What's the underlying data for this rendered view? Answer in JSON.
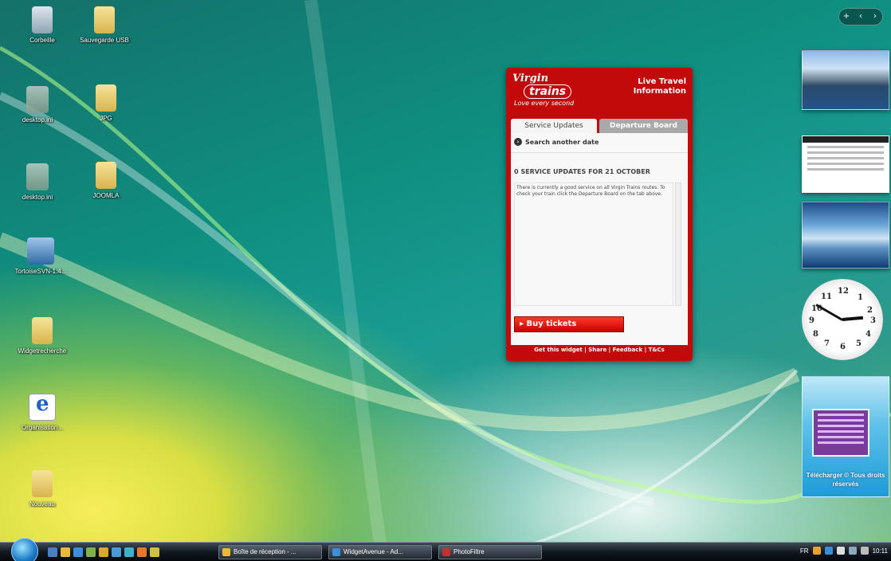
{
  "desktop": {
    "icons": [
      {
        "label": "Corbeille",
        "icon": "recycle-bin-icon"
      },
      {
        "label": "Sauvegarde USB",
        "icon": "folder-icon"
      },
      {
        "label": "desktop.ini",
        "icon": "settings-file-icon"
      },
      {
        "label": "JPG",
        "icon": "folder-icon"
      },
      {
        "label": "desktop.ini",
        "icon": "settings-file-icon"
      },
      {
        "label": "JOOMLA",
        "icon": "folder-icon"
      },
      {
        "label": "TortoiseSVN-1.4...",
        "icon": "installer-icon"
      },
      {
        "label": "Widgetrecherche",
        "icon": "folder-icon"
      },
      {
        "label": "Organisation...",
        "icon": "internet-explorer-icon"
      },
      {
        "label": "Nouveau",
        "icon": "folder-icon"
      }
    ]
  },
  "sidebar_controls": {
    "add": "+",
    "prev": "‹",
    "next": "›"
  },
  "virgin_widget": {
    "brand": "Virgin",
    "brand_sub": "trains",
    "tagline": "Love every second",
    "header": "Live Travel Information",
    "tabs": [
      "Service Updates",
      "Departure Board"
    ],
    "search_link": "Search another date",
    "updates_heading": "0 SERVICE UPDATES FOR 21 OCTOBER",
    "body_text": "There is currently a good service on all Virgin Trains routes. To check your train click the Departure Board on the tab above.",
    "buy_button": "Buy tickets",
    "footer": "Get this widget | Share | Feedback | T&Cs",
    "accent": "#c20a0a"
  },
  "clock": {
    "numerals": [
      "12",
      "1",
      "2",
      "3",
      "4",
      "5",
      "6",
      "7",
      "8",
      "9",
      "10",
      "11"
    ],
    "hour": 2,
    "minute": 50
  },
  "promo_gadget": {
    "text": "Télécharger © Tous droits réservés"
  },
  "taskbar": {
    "tasks": [
      {
        "label": "Boîte de réception - ...",
        "icon": "mail-icon"
      },
      {
        "label": "WidgetAvenue - Ad...",
        "icon": "browser-icon"
      },
      {
        "label": "PhotoFiltre",
        "icon": "photo-editor-icon"
      }
    ],
    "language": "FR",
    "time": "10:11"
  }
}
